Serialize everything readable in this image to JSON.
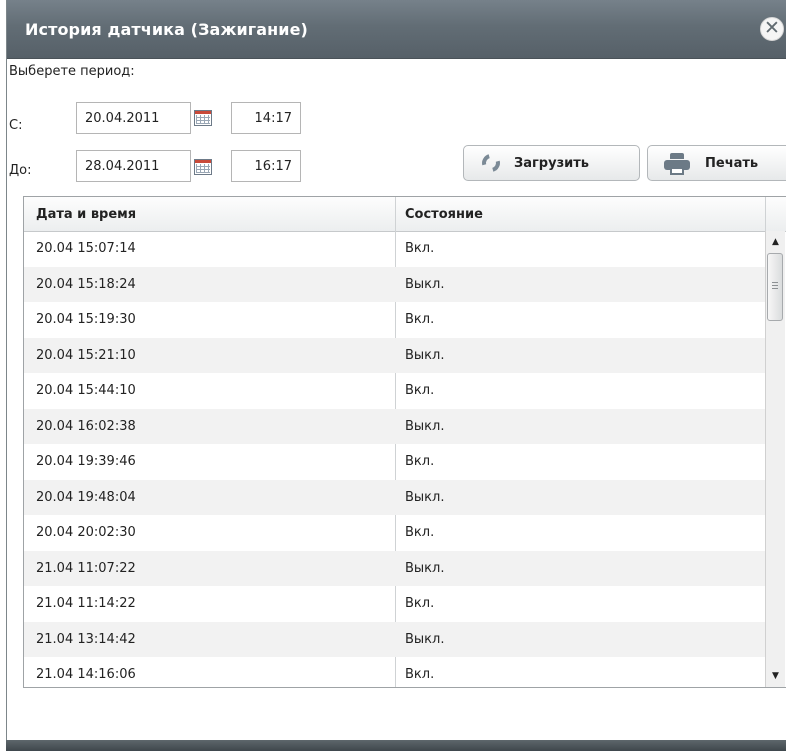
{
  "dialog": {
    "title": "История датчика (Зажигание)",
    "close_icon": "close-icon",
    "close_glyph": "✕"
  },
  "period": {
    "prompt": "Выберете период:",
    "from_label": "С:",
    "to_label": "До:",
    "from_date": "20.04.2011",
    "from_time": "14:17",
    "to_date": "28.04.2011",
    "to_time": "16:17",
    "calendar_icon": "calendar-icon"
  },
  "toolbar": {
    "load_label": "Загрузить",
    "load_icon": "reload-icon",
    "print_label": "Печать",
    "print_icon": "printer-icon"
  },
  "table": {
    "columns": [
      "Дата и время",
      "Состояние"
    ],
    "rows": [
      [
        "20.04 15:07:14",
        "Вкл."
      ],
      [
        "20.04 15:18:24",
        "Выкл."
      ],
      [
        "20.04 15:19:30",
        "Вкл."
      ],
      [
        "20.04 15:21:10",
        "Выкл."
      ],
      [
        "20.04 15:44:10",
        "Вкл."
      ],
      [
        "20.04 16:02:38",
        "Выкл."
      ],
      [
        "20.04 19:39:46",
        "Вкл."
      ],
      [
        "20.04 19:48:04",
        "Выкл."
      ],
      [
        "20.04 20:02:30",
        "Вкл."
      ],
      [
        "21.04 11:07:22",
        "Выкл."
      ],
      [
        "21.04 11:14:22",
        "Вкл."
      ],
      [
        "21.04 13:14:42",
        "Выкл."
      ],
      [
        "21.04 14:16:06",
        "Вкл."
      ]
    ]
  },
  "colors": {
    "titlebar": "#626d75",
    "row_alt": "#f2f2f2",
    "border": "#9fa3a6"
  }
}
